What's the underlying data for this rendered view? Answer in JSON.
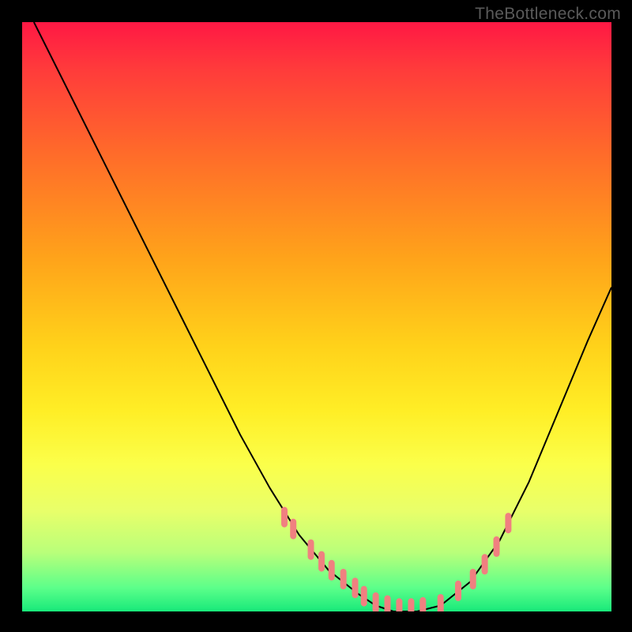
{
  "watermark": "TheBottleneck.com",
  "chart_data": {
    "type": "line",
    "title": "",
    "xlabel": "",
    "ylabel": "",
    "xlim": [
      0,
      100
    ],
    "ylim": [
      0,
      100
    ],
    "background_gradient": {
      "top": "#ff1844",
      "bottom": "#18e97a"
    },
    "series": [
      {
        "name": "curve",
        "color": "#000000",
        "x": [
          2,
          7,
          12,
          17,
          22,
          27,
          32,
          37,
          42,
          47,
          52,
          57,
          60,
          63,
          67,
          71,
          76,
          81,
          86,
          91,
          96,
          100
        ],
        "y": [
          100,
          90,
          80,
          70,
          60,
          50,
          40,
          30,
          21,
          13,
          7,
          3,
          1,
          0,
          0,
          1,
          5,
          12,
          22,
          34,
          46,
          55
        ]
      },
      {
        "name": "tick-marks",
        "color": "#f08080",
        "type": "scatter",
        "x": [
          44.5,
          46,
          49,
          50.8,
          52.5,
          54.5,
          56.5,
          58,
          60,
          62,
          64,
          66,
          68,
          71,
          74,
          76.5,
          78.5,
          80.5,
          82.5
        ],
        "y": [
          16,
          14,
          10.5,
          8.5,
          7,
          5.5,
          4,
          2.6,
          1.5,
          1,
          0.5,
          0.5,
          0.7,
          1.2,
          3.5,
          5.5,
          8,
          11,
          15
        ]
      }
    ]
  }
}
